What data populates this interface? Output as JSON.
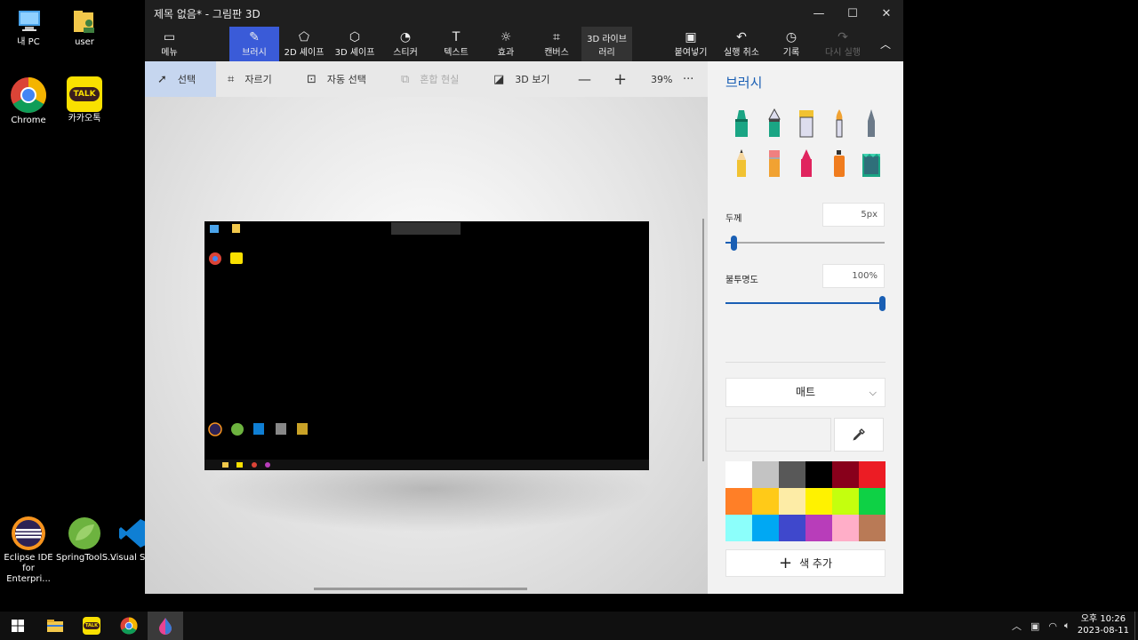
{
  "desktop": {
    "icons": [
      {
        "label": "내 PC",
        "icon": "pc-icon"
      },
      {
        "label": "user",
        "icon": "user-folder-icon"
      },
      {
        "label": "Chrome",
        "icon": "chrome-icon"
      },
      {
        "label": "카카오톡",
        "icon": "kakaotalk-icon"
      },
      {
        "label": "Eclipse IDE for Enterpri...",
        "icon": "eclipse-icon"
      },
      {
        "label": "SpringToolS...",
        "icon": "spring-tools-icon"
      },
      {
        "label": "Visual S Cod",
        "icon": "vscode-icon"
      }
    ]
  },
  "window": {
    "title": "제목 없음* - 그림판 3D",
    "controls": {
      "minimize": "—",
      "maximize": "☐",
      "close": "✕"
    }
  },
  "ribbon": {
    "menu": "메뉴",
    "brush": "브러시",
    "shapes2d": "2D 셰이프",
    "shapes3d": "3D 셰이프",
    "stickers": "스티커",
    "text": "텍스트",
    "effects": "효과",
    "canvas": "캔버스",
    "library_line1": "3D 라이브",
    "library_line2": "러리",
    "paste": "붙여넣기",
    "undo": "실행 취소",
    "history": "기록",
    "redo": "다시 실행"
  },
  "toolbar": {
    "select": "선택",
    "crop": "자르기",
    "magic_select": "자동 선택",
    "mixed_reality": "혼합 현실",
    "view3d": "3D 보기",
    "zoom": "39%",
    "more": "···"
  },
  "panel": {
    "title": "브러시",
    "brushes": [
      {
        "name": "marker",
        "color": "#1aa584"
      },
      {
        "name": "calligraphy-pen",
        "color": "#1aa584"
      },
      {
        "name": "oil-brush",
        "color": "#f1c232"
      },
      {
        "name": "watercolor",
        "color": "#f1a232"
      },
      {
        "name": "pixel-pen",
        "color": "#6c7a89"
      },
      {
        "name": "pencil",
        "color": "#f1c232"
      },
      {
        "name": "eraser",
        "color": "#f08080"
      },
      {
        "name": "crayon",
        "color": "#e0245e"
      },
      {
        "name": "spray-can",
        "color": "#f07c1e"
      },
      {
        "name": "fill",
        "color": "#1aa584"
      }
    ],
    "thickness_label": "두께",
    "thickness_value": "5px",
    "thickness_level": 0.05,
    "opacity_label": "불투명도",
    "opacity_value": "100%",
    "opacity_level": 1.0,
    "finish": "매트",
    "add_color": "색 추가",
    "palette": [
      "#ffffff",
      "#c3c3c3",
      "#585858",
      "#000000",
      "#88001b",
      "#ec1c24",
      "#ff7f27",
      "#ffca18",
      "#fdeca6",
      "#fff200",
      "#c4ff0e",
      "#0ed145",
      "#8cfffb",
      "#00a8f3",
      "#3f48cc",
      "#b83dba",
      "#ffaec8",
      "#b97a56"
    ],
    "accent": "#1a5fb4"
  },
  "taskbar": {
    "items": [
      "windows-start-icon",
      "file-explorer-icon",
      "kakaotalk-icon",
      "chrome-icon",
      "paint3d-icon"
    ],
    "time": "오후 10:26",
    "date": "2023-08-11"
  }
}
